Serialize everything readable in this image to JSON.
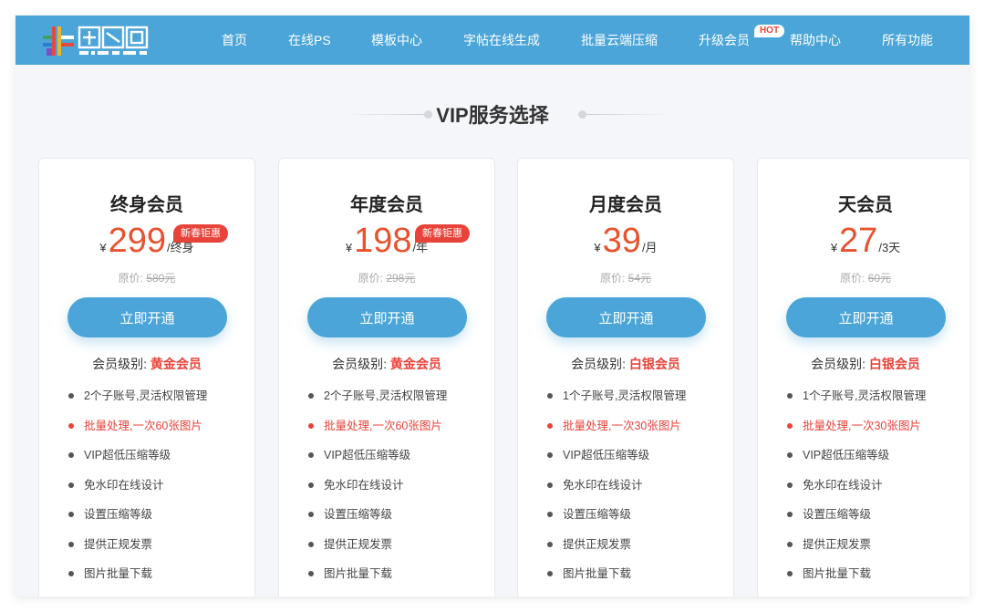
{
  "nav": {
    "items": [
      "首页",
      "在线PS",
      "模板中心",
      "字帖在线生成",
      "批量云端压缩",
      "升级会员",
      "帮助中心",
      "所有功能"
    ],
    "hot_badge": "HOT"
  },
  "section_title": "VIP服务选择",
  "colors": {
    "header": "#4ba5d8",
    "accent": "#e8532f",
    "highlight": "#e8433a"
  },
  "plans": [
    {
      "name": "终身会员",
      "currency": "¥",
      "price": "299",
      "period": "/终身",
      "promo": "新春钜惠",
      "orig_label": "原价: ",
      "orig_price": "580元",
      "cta": "立即开通",
      "level_label": "会员级别: ",
      "level": "黄金会员",
      "features": [
        "2个子账号,灵活权限管理",
        "批量处理,一次60张图片",
        "VIP超低压缩等级",
        "免水印在线设计",
        "设置压缩等级",
        "提供正规发票",
        "图片批量下载"
      ]
    },
    {
      "name": "年度会员",
      "currency": "¥",
      "price": "198",
      "period": "/年",
      "promo": "新春钜惠",
      "orig_label": "原价: ",
      "orig_price": "298元",
      "cta": "立即开通",
      "level_label": "会员级别: ",
      "level": "黄金会员",
      "features": [
        "2个子账号,灵活权限管理",
        "批量处理,一次60张图片",
        "VIP超低压缩等级",
        "免水印在线设计",
        "设置压缩等级",
        "提供正规发票",
        "图片批量下载"
      ]
    },
    {
      "name": "月度会员",
      "currency": "¥",
      "price": "39",
      "period": "/月",
      "promo": "",
      "orig_label": "原价: ",
      "orig_price": "54元",
      "cta": "立即开通",
      "level_label": "会员级别: ",
      "level": "白银会员",
      "features": [
        "1个子账号,灵活权限管理",
        "批量处理,一次30张图片",
        "VIP超低压缩等级",
        "免水印在线设计",
        "设置压缩等级",
        "提供正规发票",
        "图片批量下载"
      ]
    },
    {
      "name": "天会员",
      "currency": "¥",
      "price": "27",
      "period": "/3天",
      "promo": "",
      "orig_label": "原价: ",
      "orig_price": "60元",
      "cta": "立即开通",
      "level_label": "会员级别: ",
      "level": "白银会员",
      "features": [
        "1个子账号,灵活权限管理",
        "批量处理,一次30张图片",
        "VIP超低压缩等级",
        "免水印在线设计",
        "设置压缩等级",
        "提供正规发票",
        "图片批量下载"
      ]
    }
  ]
}
